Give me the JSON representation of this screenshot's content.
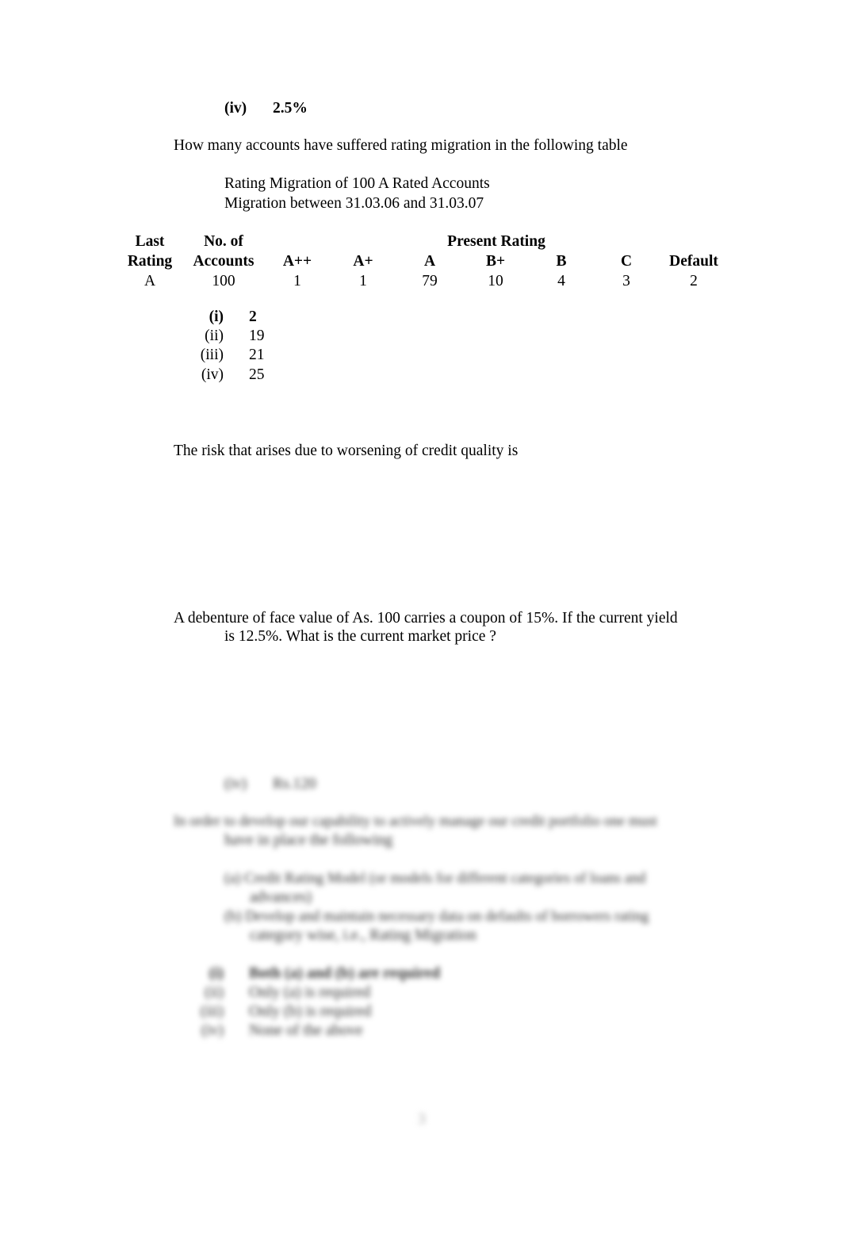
{
  "prev_option": {
    "label": "(iv)",
    "value": "2.5%"
  },
  "question1": {
    "text": "How many accounts have suffered rating migration in the following table",
    "caption_line1": "Rating Migration of 100 A Rated Accounts",
    "caption_line2": "Migration between 31.03.06 and 31.03.07",
    "table": {
      "header_top": {
        "last": "Last",
        "no_of": "No. of",
        "present": "Present Rating"
      },
      "header_bottom": [
        "Rating",
        "Accounts",
        "A++",
        "A+",
        "A",
        "B+",
        "B",
        "C",
        "Default"
      ],
      "row": [
        "A",
        "100",
        "1",
        "1",
        "79",
        "10",
        "4",
        "3",
        "2"
      ]
    },
    "options": [
      {
        "label": "(i)",
        "value": "2",
        "bold": true
      },
      {
        "label": "(ii)",
        "value": "19",
        "bold": false
      },
      {
        "label": "(iii)",
        "value": "21",
        "bold": false
      },
      {
        "label": "(iv)",
        "value": "25",
        "bold": false
      }
    ]
  },
  "question2": {
    "text": "The risk that arises due to worsening of credit quality is"
  },
  "question3": {
    "line1": "A debenture of face value of As. 100 carries a coupon of 15%. If the current yield",
    "line2": "is 12.5%.  What is the current market price ?"
  },
  "blurred": {
    "option": {
      "label": "(iv)",
      "value": "Rs.120"
    },
    "question_line1": "In order to develop our capability to actively manage our credit portfolio one must",
    "question_line2": "have in place the following",
    "point_a_line1": "(a) Credit Rating Model (or models for different categories of loans and",
    "point_a_line2": "advances)",
    "point_b_line1": "(b) Develop and maintain necessary data on defaults of borrowers rating",
    "point_b_line2": "category wise, i.e., Rating Migration",
    "options": [
      {
        "label": "(i)",
        "value": "Both (a) and (b) are required",
        "bold": true
      },
      {
        "label": "(ii)",
        "value": "Only (a) is required",
        "bold": false
      },
      {
        "label": "(iii)",
        "value": "Only (b) is required",
        "bold": false
      },
      {
        "label": "(iv)",
        "value": "None of the above",
        "bold": false
      }
    ],
    "page_number": "3"
  }
}
